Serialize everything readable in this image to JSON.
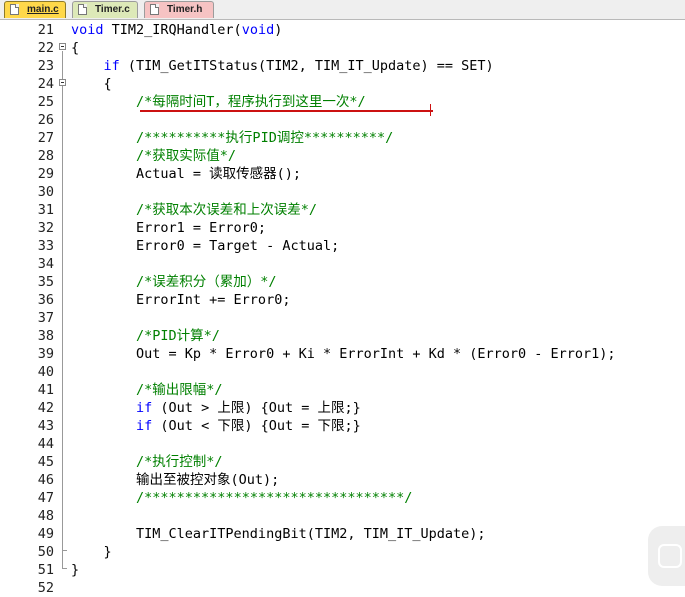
{
  "tabs": [
    {
      "label": "main.c",
      "active": true
    },
    {
      "label": "Timer.c",
      "active": false
    },
    {
      "label": "Timer.h",
      "active": false
    }
  ],
  "editor": {
    "lines": [
      {
        "no": "21",
        "segments": [
          {
            "t": "void",
            "c": "kw"
          },
          {
            "t": " TIM2_IRQHandler(",
            "c": "tx"
          },
          {
            "t": "void",
            "c": "kw"
          },
          {
            "t": ")",
            "c": "tx"
          }
        ]
      },
      {
        "no": "22",
        "segments": [
          {
            "t": "{",
            "c": "tx"
          }
        ]
      },
      {
        "no": "23",
        "segments": [
          {
            "t": "    ",
            "c": "tx"
          },
          {
            "t": "if",
            "c": "kw"
          },
          {
            "t": " (TIM_GetITStatus(TIM2, TIM_IT_Update) == SET)",
            "c": "tx"
          }
        ]
      },
      {
        "no": "24",
        "segments": [
          {
            "t": "    {",
            "c": "tx"
          }
        ]
      },
      {
        "no": "25",
        "segments": [
          {
            "t": "        ",
            "c": "tx"
          },
          {
            "t": "/*每隔时间T，程序执行到这里一次*/",
            "c": "cm"
          }
        ]
      },
      {
        "no": "26",
        "segments": []
      },
      {
        "no": "27",
        "segments": [
          {
            "t": "        ",
            "c": "tx"
          },
          {
            "t": "/**********执行PID调控**********/",
            "c": "cm"
          }
        ]
      },
      {
        "no": "28",
        "segments": [
          {
            "t": "        ",
            "c": "tx"
          },
          {
            "t": "/*获取实际值*/",
            "c": "cm"
          }
        ]
      },
      {
        "no": "29",
        "segments": [
          {
            "t": "        Actual = 读取传感器();",
            "c": "tx"
          }
        ]
      },
      {
        "no": "30",
        "segments": []
      },
      {
        "no": "31",
        "segments": [
          {
            "t": "        ",
            "c": "tx"
          },
          {
            "t": "/*获取本次误差和上次误差*/",
            "c": "cm"
          }
        ]
      },
      {
        "no": "32",
        "segments": [
          {
            "t": "        Error1 = Error0;",
            "c": "tx"
          }
        ]
      },
      {
        "no": "33",
        "segments": [
          {
            "t": "        Error0 = Target - Actual;",
            "c": "tx"
          }
        ]
      },
      {
        "no": "34",
        "segments": []
      },
      {
        "no": "35",
        "segments": [
          {
            "t": "        ",
            "c": "tx"
          },
          {
            "t": "/*误差积分（累加）*/",
            "c": "cm"
          }
        ]
      },
      {
        "no": "36",
        "segments": [
          {
            "t": "        ErrorInt += Error0;",
            "c": "tx"
          }
        ]
      },
      {
        "no": "37",
        "segments": []
      },
      {
        "no": "38",
        "segments": [
          {
            "t": "        ",
            "c": "tx"
          },
          {
            "t": "/*PID计算*/",
            "c": "cm"
          }
        ]
      },
      {
        "no": "39",
        "segments": [
          {
            "t": "        Out = Kp * Error0 + Ki * ErrorInt + Kd * (Error0 - Error1);",
            "c": "tx"
          }
        ]
      },
      {
        "no": "40",
        "segments": []
      },
      {
        "no": "41",
        "segments": [
          {
            "t": "        ",
            "c": "tx"
          },
          {
            "t": "/*输出限幅*/",
            "c": "cm"
          }
        ]
      },
      {
        "no": "42",
        "segments": [
          {
            "t": "        ",
            "c": "tx"
          },
          {
            "t": "if",
            "c": "kw"
          },
          {
            "t": " (Out > 上限) {Out = 上限;}",
            "c": "tx"
          }
        ]
      },
      {
        "no": "43",
        "segments": [
          {
            "t": "        ",
            "c": "tx"
          },
          {
            "t": "if",
            "c": "kw"
          },
          {
            "t": " (Out < 下限) {Out = 下限;}",
            "c": "tx"
          }
        ]
      },
      {
        "no": "44",
        "segments": []
      },
      {
        "no": "45",
        "segments": [
          {
            "t": "        ",
            "c": "tx"
          },
          {
            "t": "/*执行控制*/",
            "c": "cm"
          }
        ]
      },
      {
        "no": "46",
        "segments": [
          {
            "t": "        输出至被控对象(Out);",
            "c": "tx"
          }
        ]
      },
      {
        "no": "47",
        "segments": [
          {
            "t": "        ",
            "c": "tx"
          },
          {
            "t": "/********************************/",
            "c": "cm"
          }
        ]
      },
      {
        "no": "48",
        "segments": []
      },
      {
        "no": "49",
        "segments": [
          {
            "t": "        TIM_ClearITPendingBit(TIM2, TIM_IT_Update);",
            "c": "tx"
          }
        ]
      },
      {
        "no": "50",
        "segments": [
          {
            "t": "    }",
            "c": "tx"
          }
        ]
      },
      {
        "no": "51",
        "segments": [
          {
            "t": "}",
            "c": "tx"
          }
        ]
      },
      {
        "no": "52",
        "segments": []
      }
    ]
  },
  "colors": {
    "keyword": "#0000ff",
    "comment": "#008000",
    "text": "#000000",
    "highlight": "#cc1111"
  }
}
